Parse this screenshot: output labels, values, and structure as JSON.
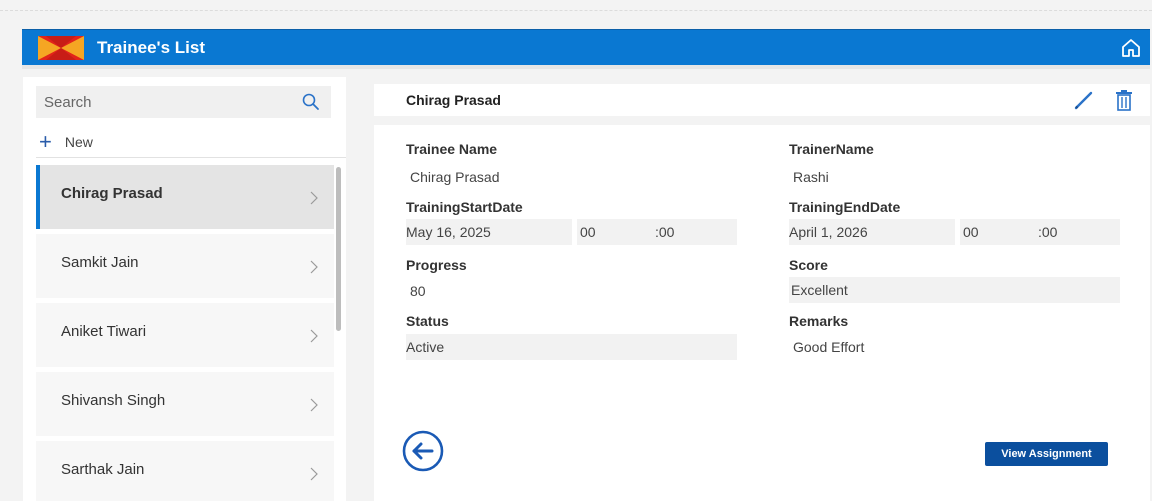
{
  "header": {
    "title": "Trainee's List",
    "brand_colors": [
      "#e2231a",
      "#f5a623"
    ],
    "accent": "#0a78d2"
  },
  "sidebar": {
    "search": {
      "placeholder": "Search"
    },
    "new_label": "New",
    "items": [
      {
        "label": "Chirag Prasad",
        "selected": true
      },
      {
        "label": "Samkit Jain"
      },
      {
        "label": "Aniket Tiwari"
      },
      {
        "label": "Shivansh Singh"
      },
      {
        "label": "Sarthak Jain"
      }
    ]
  },
  "detail": {
    "title": "Chirag Prasad",
    "fields": {
      "trainee_name": {
        "label": "Trainee Name",
        "value": "Chirag Prasad"
      },
      "trainer_name": {
        "label": "TrainerName",
        "value": "Rashi"
      },
      "start_date": {
        "label": "TrainingStartDate",
        "date": "May 16, 2025",
        "hour": "00",
        "minute": ":00"
      },
      "end_date": {
        "label": "TrainingEndDate",
        "date": "April 1, 2026",
        "hour": "00",
        "minute": ":00"
      },
      "progress": {
        "label": "Progress",
        "value": "80"
      },
      "score": {
        "label": "Score",
        "value": "Excellent"
      },
      "status": {
        "label": "Status",
        "value": "Active"
      },
      "remarks": {
        "label": "Remarks",
        "value": "Good Effort"
      }
    },
    "view_assignment_label": "View Assignment"
  },
  "icons": {
    "home": "home-icon",
    "search": "search-icon",
    "edit": "pencil-icon",
    "delete": "trash-icon",
    "back": "back-arrow-icon",
    "chevron": "chevron-right-icon"
  }
}
